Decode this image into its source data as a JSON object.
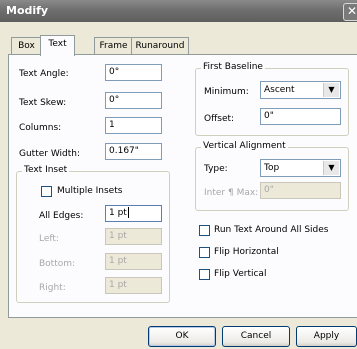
{
  "window": {
    "title": "Modify",
    "close_label": "✕"
  },
  "tabs": [
    "Box",
    "Text",
    "Frame",
    "Runaround"
  ],
  "active_tab": "Text",
  "text_fields": {
    "text_angle": {
      "label": "Text Angle:",
      "value": "0°"
    },
    "text_skew": {
      "label": "Text Skew:",
      "value": "0°"
    },
    "columns": {
      "label": "Columns:",
      "value": "1"
    },
    "gutter_width": {
      "label": "Gutter Width:",
      "value": "0.167\""
    }
  },
  "text_inset": {
    "group_title": "Text Inset",
    "multiple_insets": {
      "label": "Multiple Insets",
      "checked": false
    },
    "all_edges": {
      "label": "All Edges:",
      "value": "1 pt"
    },
    "left": {
      "label": "Left:",
      "value": "1 pt"
    },
    "bottom": {
      "label": "Bottom:",
      "value": "1 pt"
    },
    "right": {
      "label": "Right:",
      "value": "1 pt"
    }
  },
  "first_baseline": {
    "group_title": "First Baseline",
    "minimum": {
      "label": "Minimum:",
      "value": "Ascent"
    },
    "offset": {
      "label": "Offset:",
      "value": "0\""
    }
  },
  "vertical_alignment": {
    "group_title": "Vertical Alignment",
    "type": {
      "label": "Type:",
      "value": "Top"
    },
    "inter_max": {
      "label": "Inter ¶ Max:",
      "value": "0\""
    }
  },
  "options": [
    {
      "label": "Run Text Around All Sides",
      "checked": false
    },
    {
      "label": "Flip Horizontal",
      "checked": false
    },
    {
      "label": "Flip Vertical",
      "checked": false
    }
  ],
  "buttons": {
    "ok": "OK",
    "cancel": "Cancel",
    "apply": "Apply"
  }
}
